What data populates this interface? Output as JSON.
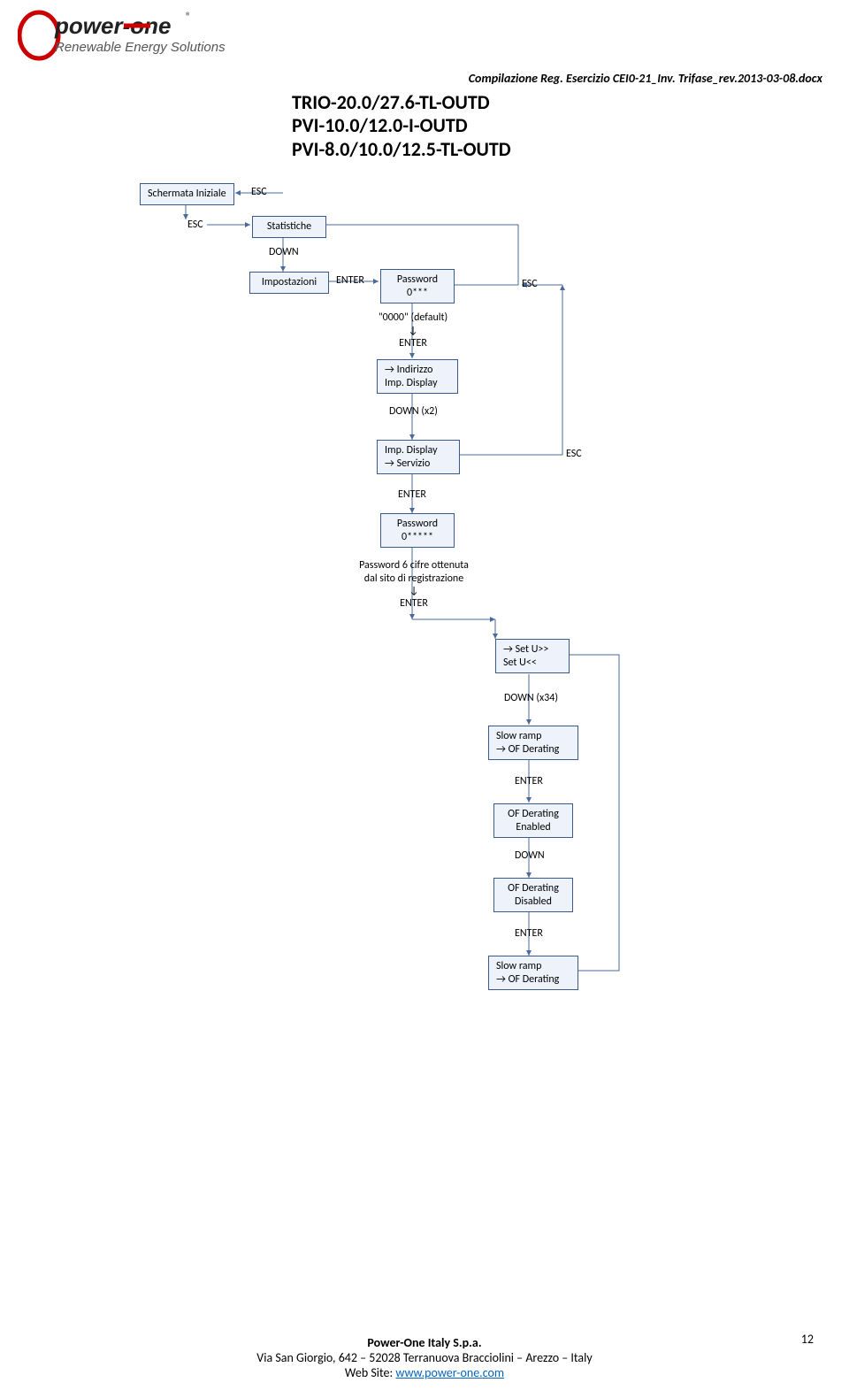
{
  "header": {
    "logo_top": "power-one",
    "logo_tm": "®",
    "logo_sub": "Renewable Energy Solutions",
    "doc_path": "Compilazione Reg. Esercizio CEI0-21_Inv. Trifase_rev.2013-03-08.docx"
  },
  "title": {
    "l1": "TRIO-20.0/27.6-TL-OUTD",
    "l2": "PVI-10.0/12.0-I-OUTD",
    "l3": "PVI-8.0/10.0/12.5-TL-OUTD"
  },
  "flow": {
    "schermata": "Schermata Iniziale",
    "statistiche": "Statistiche",
    "impostazioni": "Impostazioni",
    "pwd1": "Password\n0***",
    "indirizzo": "→  Indirizzo\nImp. Display",
    "impdisplay": "Imp. Display\n→  Servizio",
    "pwd2": "Password\n0*****",
    "setu": "→  Set U>>\nSet U<<",
    "slow1": "Slow ramp\n→  OF Derating",
    "ofen": "OF Derating\nEnabled",
    "ofdis": "OF Derating\nDisabled",
    "slow2": "Slow ramp\n→  OF Derating"
  },
  "labels": {
    "esc": "ESC",
    "down": "DOWN",
    "enter": "ENTER",
    "default": "\"0000\" (default)\n↓\nENTER",
    "downx2": "DOWN (x2)",
    "pw6": "Password 6 cifre ottenuta\ndal sito di registrazione\n↓\nENTER",
    "downx34": "DOWN (x34)"
  },
  "footer": {
    "company": "Power-One Italy S.p.a.",
    "address": "Via San Giorgio, 642 – 52028 Terranuova Bracciolini – Arezzo – Italy",
    "web_label": "Web Site: ",
    "web_url": "www.power-one.com",
    "page": "12"
  }
}
